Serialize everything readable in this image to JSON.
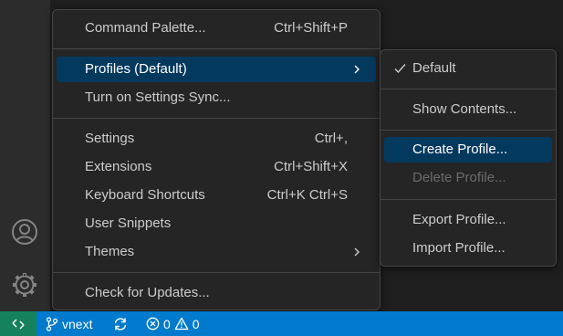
{
  "colors": {
    "menu_background": "#252526",
    "menu_border": "#454545",
    "active_item": "#04395e",
    "statusbar": "#007acc",
    "remote_indicator": "#16825d",
    "activity_bar": "#2c2c2c"
  },
  "activity_bar": {
    "icons": [
      "account-icon",
      "manage-gear-icon"
    ]
  },
  "manage_menu": {
    "items": [
      {
        "label": "Command Palette...",
        "shortcut": "Ctrl+Shift+P"
      },
      {
        "label": "Profiles (Default)",
        "submenu": true,
        "active": true
      },
      {
        "label": "Turn on Settings Sync..."
      },
      {
        "label": "Settings",
        "shortcut": "Ctrl+,"
      },
      {
        "label": "Extensions",
        "shortcut": "Ctrl+Shift+X"
      },
      {
        "label": "Keyboard Shortcuts",
        "shortcut": "Ctrl+K Ctrl+S"
      },
      {
        "label": "User Snippets"
      },
      {
        "label": "Themes",
        "submenu": true
      },
      {
        "label": "Check for Updates..."
      }
    ]
  },
  "profiles_submenu": {
    "items": [
      {
        "label": "Default",
        "checked": true
      },
      {
        "label": "Show Contents..."
      },
      {
        "label": "Create Profile...",
        "active": true
      },
      {
        "label": "Delete Profile...",
        "disabled": true
      },
      {
        "label": "Export Profile..."
      },
      {
        "label": "Import Profile..."
      }
    ]
  },
  "statusbar": {
    "branch": "vnext",
    "errors": "0",
    "warnings": "0"
  }
}
